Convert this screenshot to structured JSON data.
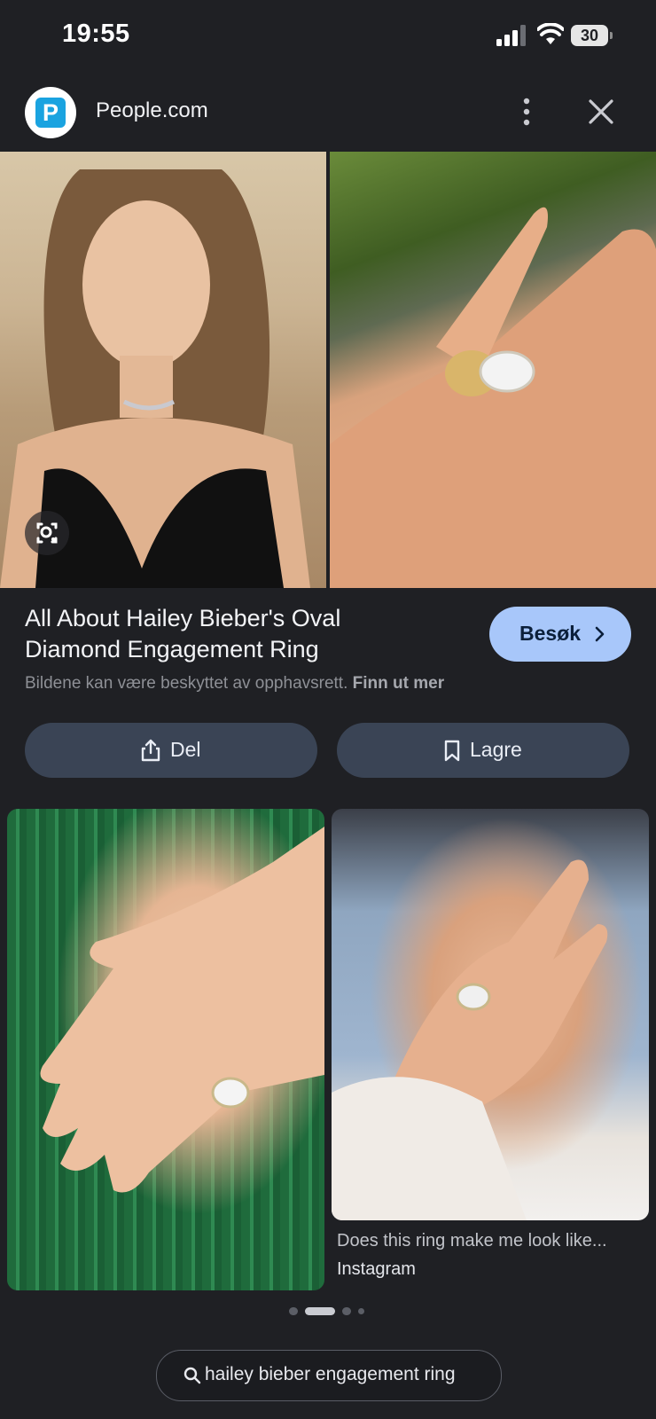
{
  "status_bar": {
    "time": "19:55",
    "battery": "30"
  },
  "header": {
    "site_name": "People.com",
    "logo_letter": "P"
  },
  "result": {
    "title": "All About Hailey Bieber's Oval Diamond Engagement Ring",
    "visit_label": "Besøk",
    "copyright_text": "Bildene kan være beskyttet av opphavsrett.",
    "copyright_link": "Finn ut mer"
  },
  "actions": {
    "share_label": "Del",
    "save_label": "Lagre"
  },
  "related": [
    {
      "caption": "",
      "source": ""
    },
    {
      "caption": "Does this ring make me look like...",
      "source": "Instagram"
    }
  ],
  "search": {
    "query": "hailey bieber engagement ring"
  },
  "colors": {
    "background": "#1f2024",
    "accent": "#a8c7fa",
    "button": "#3a4455"
  }
}
